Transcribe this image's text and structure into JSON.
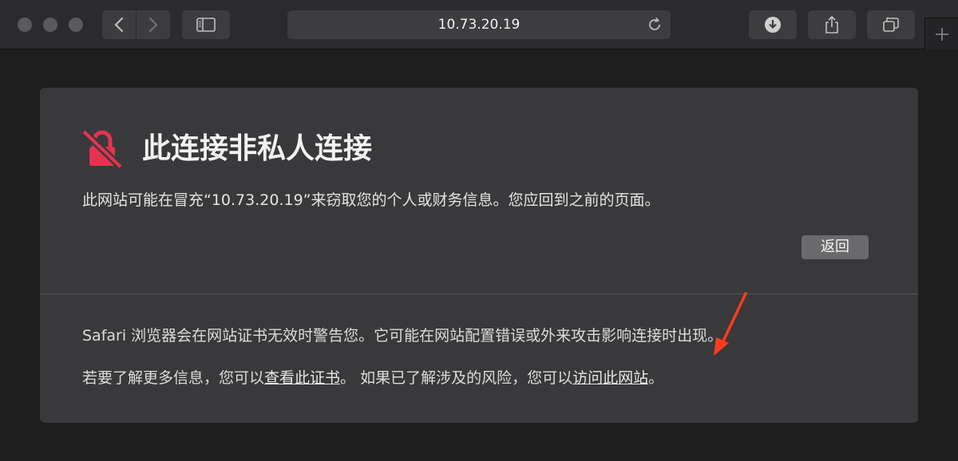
{
  "toolbar": {
    "url": "10.73.20.19",
    "icons": [
      "back-icon",
      "forward-icon",
      "sidebar-icon",
      "reload-icon",
      "download-icon",
      "share-icon",
      "tabs-icon",
      "new-tab-icon"
    ]
  },
  "warning": {
    "title": "此连接非私人连接",
    "description": "此网站可能在冒充“10.73.20.19”来窃取您的个人或财务信息。您应回到之前的页面。",
    "back_label": "返回",
    "info_line1": "Safari 浏览器会在网站证书无效时警告您。它可能在网站配置错误或外来攻击影响连接时出现。",
    "info_line2_prefix": "若要了解更多信息，您可以",
    "view_certificate_link": "查看此证书",
    "info_line2_middle": "。 如果已了解涉及的风险，您可以",
    "visit_site_link": "访问此网站",
    "info_line2_suffix": "。"
  },
  "colors": {
    "lock_icon": "#e5334f",
    "annotation_arrow": "#ff3b1f",
    "panel_bg": "#39393b",
    "page_bg": "#1e1e1f"
  }
}
